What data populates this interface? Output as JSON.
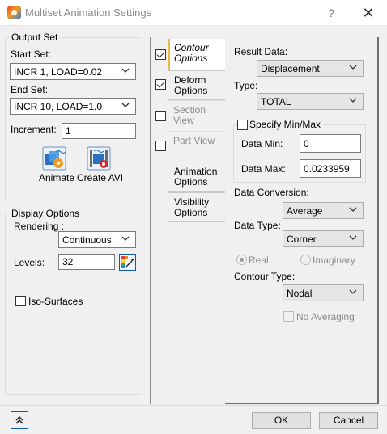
{
  "window": {
    "title": "Multiset Animation Settings",
    "help": "?",
    "close": "✕"
  },
  "output_set": {
    "title": "Output Set",
    "start_label": "Start Set:",
    "start_value": "INCR 1, LOAD=0.02",
    "end_label": "End Set:",
    "end_value": "INCR 10, LOAD=1.0",
    "increment_label": "Increment:",
    "increment_value": "1",
    "animate_label": "Animate",
    "create_avi_label": "Create AVI"
  },
  "display_options": {
    "title": "Display Options",
    "rendering_label": "Rendering :",
    "rendering_value": "Continuous",
    "levels_label": "Levels:",
    "levels_value": "32",
    "iso_label": "Iso-Surfaces"
  },
  "tabs": [
    {
      "label": "Contour Options",
      "checked": true
    },
    {
      "label": "Deform Options",
      "checked": true
    },
    {
      "label": "Section View",
      "checked": false
    },
    {
      "label": "Part View",
      "checked": false
    },
    {
      "label": "Animation Options"
    },
    {
      "label": "Visibility Options"
    }
  ],
  "contour": {
    "result_data_label": "Result Data:",
    "result_data_value": "Displacement",
    "type_label": "Type:",
    "type_value": "TOTAL",
    "specify_label": "Specify Min/Max",
    "data_min_label": "Data Min:",
    "data_min_value": "0",
    "data_max_label": "Data Max:",
    "data_max_value": "0.0233959",
    "conversion_label": "Data Conversion:",
    "conversion_value": "Average",
    "data_type_label": "Data Type:",
    "data_type_value": "Corner",
    "real_label": "Real",
    "imaginary_label": "Imaginary",
    "contour_type_label": "Contour Type:",
    "contour_type_value": "Nodal",
    "no_averaging_label": "No Averaging"
  },
  "footer": {
    "ok": "OK",
    "cancel": "Cancel"
  }
}
